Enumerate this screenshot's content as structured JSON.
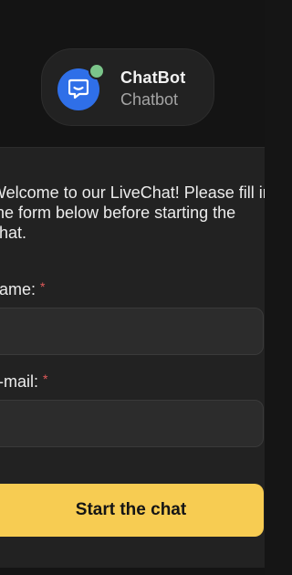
{
  "header": {
    "bot_name": "ChatBot",
    "bot_subtitle": "Chatbot",
    "avatar_icon": "chat-bubble-icon",
    "online_status_color": "#7bc58a",
    "avatar_color": "#2f6fe8"
  },
  "form": {
    "welcome_text": "Welcome to our LiveChat! Please fill in the form below before starting the chat.",
    "fields": [
      {
        "label": "Name:",
        "required_mark": "*",
        "value": ""
      },
      {
        "label": "E-mail:",
        "required_mark": "*",
        "value": ""
      }
    ],
    "submit_label": "Start the chat",
    "submit_color": "#f7cc52"
  }
}
